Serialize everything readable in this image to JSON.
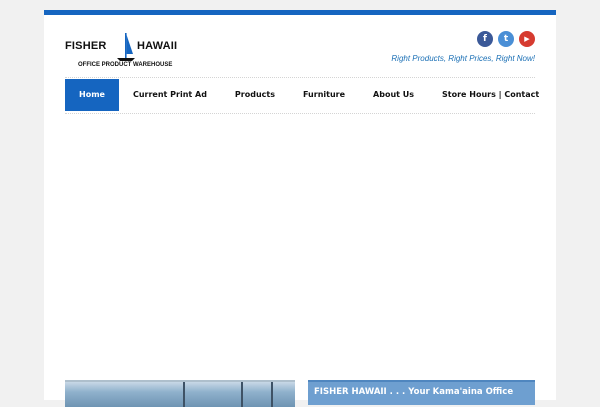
{
  "logo": {
    "name_left": "FISHER",
    "name_right": "HAWAII",
    "subtitle": "OFFICE PRODUCT WAREHOUSE"
  },
  "social": [
    {
      "glyph": "f",
      "color": "#3b5998"
    },
    {
      "glyph": "t",
      "color": "#4a8fd6"
    },
    {
      "glyph": "▶",
      "color": "#d63b30"
    }
  ],
  "tagline": "Right Products, Right Prices, Right Now!",
  "nav": {
    "items": [
      {
        "label": "Home",
        "active": true
      },
      {
        "label": "Current Print Ad"
      },
      {
        "label": "Products"
      },
      {
        "label": "Furniture"
      },
      {
        "label": "About Us"
      },
      {
        "label": "Store Hours | Contact"
      }
    ]
  },
  "info_box": {
    "headline": "FISHER HAWAII . . . Your Kama'aina Office"
  },
  "colors": {
    "accent": "#1565c0",
    "tagline": "#1a6fb5",
    "info_box": "#6e9fd0"
  }
}
